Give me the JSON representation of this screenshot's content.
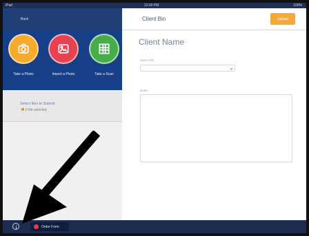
{
  "status": {
    "left": "iPad",
    "center": "12:00 PM",
    "right": "100%"
  },
  "header": {
    "back": "Back",
    "title": "Client Bin",
    "upload": "Upload"
  },
  "actions": [
    {
      "label": "Take a Photo",
      "color": "#f6ab2d",
      "icon": "camera-icon"
    },
    {
      "label": "Import a Photo",
      "color": "#e6424f",
      "icon": "image-icon"
    },
    {
      "label": "Take a Scan",
      "color": "#47ad4b",
      "icon": "scan-icon"
    }
  ],
  "selected": {
    "title": "Select files to Submit",
    "item": "0 file selected"
  },
  "main": {
    "client_name": "Client Name",
    "folder_label": "Select Bin",
    "notes_label": "Notes"
  },
  "bottom": {
    "orders": "Order Form"
  },
  "colors": {
    "sidebar": "#173f88",
    "upload": "#f6a83b",
    "accent": "#6d86a8"
  }
}
